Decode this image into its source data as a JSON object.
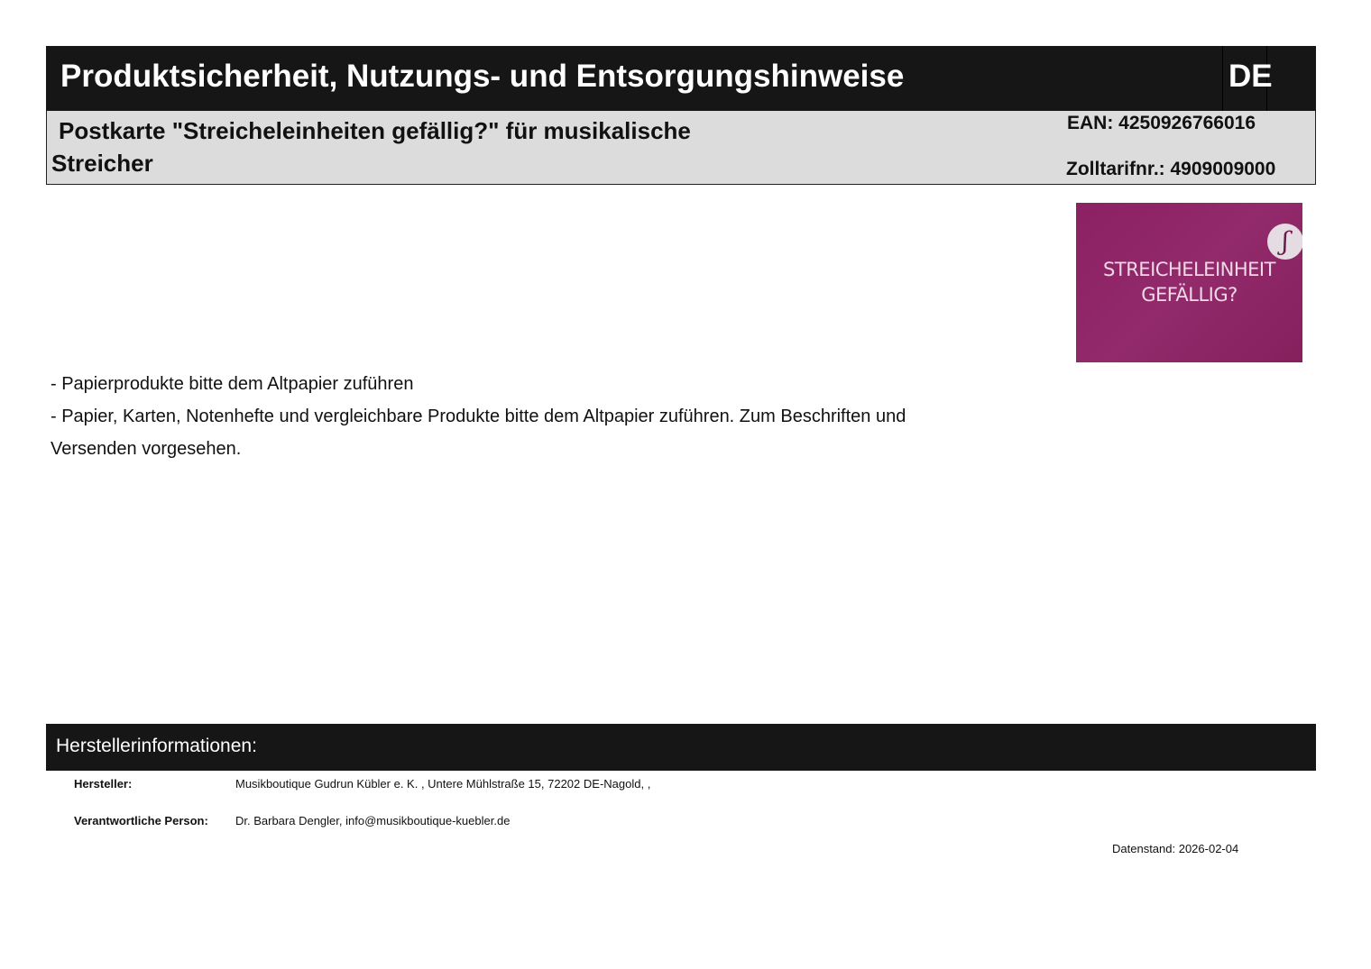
{
  "header": {
    "title": "Produktsicherheit, Nutzungs- und Entsorgungshinweise",
    "language": "DE"
  },
  "product": {
    "name": "Postkarte \"Streicheleinheiten gefällig?\" für musikalische Streicher",
    "ean": "EAN: 4250926766016",
    "tariff": "Zolltarifnr.: 4909009000"
  },
  "product_image": {
    "text_line1": "STREICHELEINHEIT",
    "text_line2": "GEFÄLLIG?",
    "badge_glyph": "ʃ",
    "color": "#8c2063"
  },
  "notes": [
    "- Papierprodukte bitte dem Altpapier zuführen",
    "- Papier, Karten, Notenhefte und vergleichbare Produkte bitte dem Altpapier zuführen. Zum Beschriften und Versenden vorgesehen."
  ],
  "manufacturer": {
    "section_title": "Herstellerinformationen:",
    "label_manufacturer": "Hersteller:",
    "value_manufacturer": "Musikboutique Gudrun Kübler e. K. , Untere Mühlstraße 15, 72202 DE-Nagold, ,",
    "label_responsible": "Verantwortliche Person:",
    "value_responsible": "Dr. Barbara Dengler, info@musikboutique-kuebler.de"
  },
  "date_stamp": "Datenstand: 2026-02-04"
}
